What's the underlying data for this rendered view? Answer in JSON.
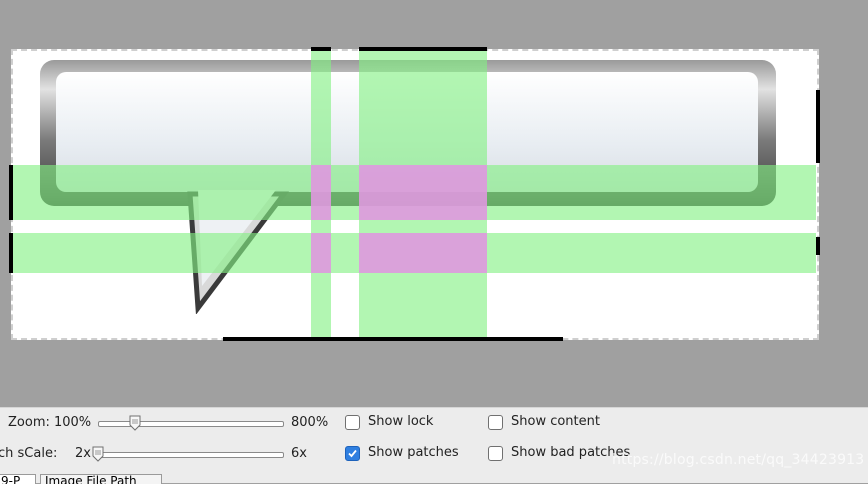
{
  "controls": {
    "zoom_label": "Zoom: 100%",
    "zoom_max_label": "800%",
    "patch_scale_label": "ch sCale:",
    "patch_scale_min_label": "2x",
    "patch_scale_max_label": "6x",
    "show_lock_label": "Show lock",
    "show_patches_label": "Show patches",
    "show_content_label": "Show content",
    "show_bad_patches_label": "Show bad patches",
    "show_lock_checked": false,
    "show_patches_checked": true,
    "show_content_checked": false,
    "show_bad_patches_checked": false
  },
  "tabs": [
    {
      "label": "9-P"
    },
    {
      "label": "Image File Path"
    }
  ],
  "watermark": "https://blog.csdn.net/qq_34423913",
  "colors": {
    "canvas_bg": "#a0a0a0",
    "patch_green": "#82f082",
    "patch_magenta": "#f582f5",
    "checkbox_accent": "#2f7fe0"
  }
}
